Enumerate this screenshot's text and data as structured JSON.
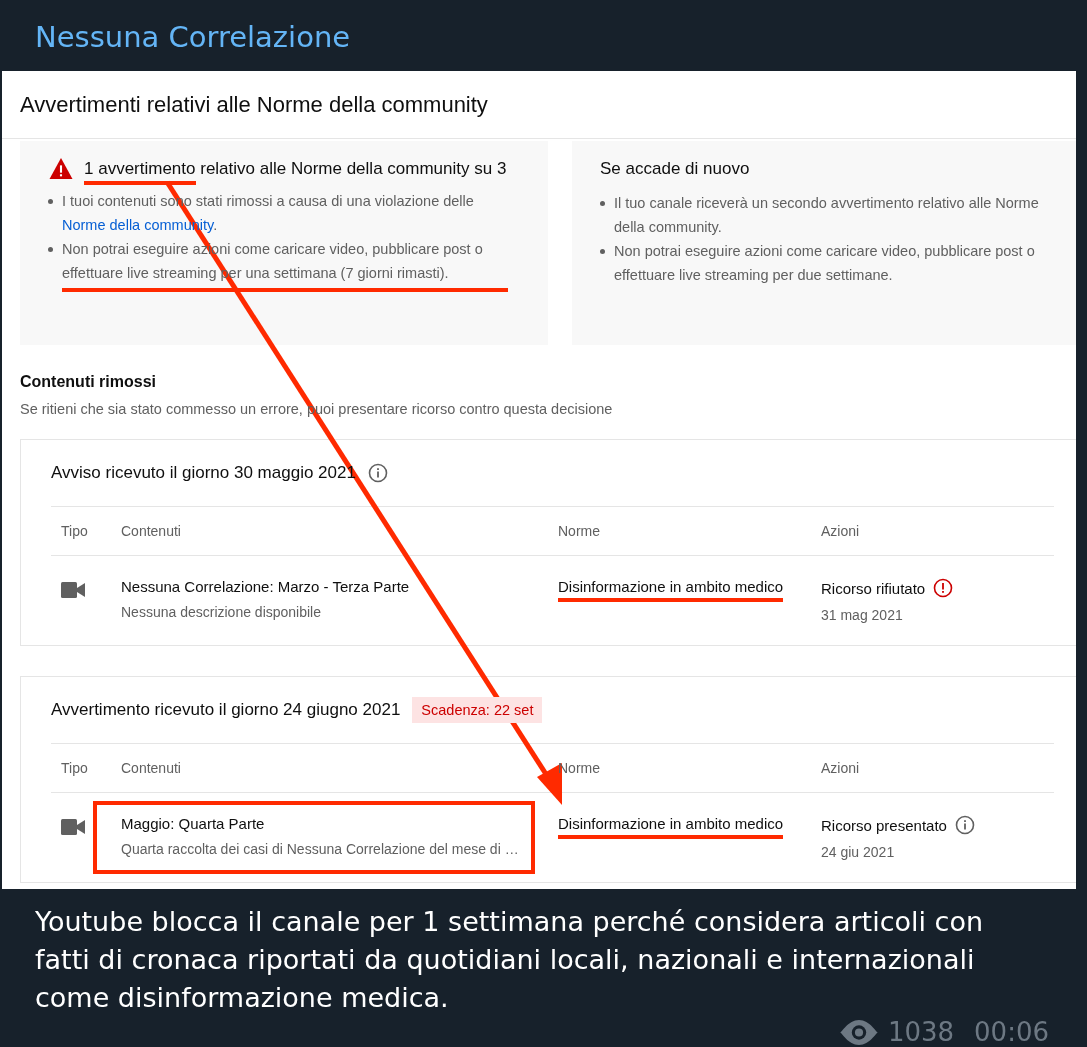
{
  "channel": {
    "name": "Nessuna Correlazione"
  },
  "page": {
    "title": "Avvertimenti relativi alle Norme della community",
    "strike_card": {
      "heading_lead": "1 avvertimento",
      "heading_rest": "relativo alle Norme della community su 3",
      "lead_underlined": true,
      "bullets": [
        {
          "text": "I tuoi contenuti sono stati rimossi a causa di una violazione delle",
          "link": "Norme della community",
          "after": ".",
          "underlined": false
        },
        {
          "text": "Non potrai eseguire azioni come caricare video, pubblicare post o effettuare live streaming per una settimana (7 giorni rimasti).",
          "underlined": true
        }
      ]
    },
    "repeat_card": {
      "heading": "Se accade di nuovo",
      "bullets": [
        {
          "text": "Il tuo canale riceverà un secondo avvertimento relativo alle Norme della community.",
          "underlined": false
        },
        {
          "text": "Non potrai eseguire azioni come caricare video, pubblicare post o effettuare live streaming per due settimane.",
          "underlined": false
        }
      ]
    },
    "removed": {
      "title": "Contenuti rimossi",
      "subtitle": "Se ritieni che sia stato commesso un errore, puoi presentare ricorso contro questa decisione"
    },
    "sections": [
      {
        "heading": "Avviso ricevuto il giorno 30 maggio 2021",
        "info_icon": true,
        "columns": [
          "Tipo",
          "Contenuti",
          "Norme",
          "Azioni"
        ],
        "rows": [
          {
            "title": "Nessuna Correlazione: Marzo - Terza Parte",
            "description": "Nessuna descrizione disponibile",
            "policy": "Disinformazione in ambito medico",
            "policy_underlined": true,
            "action": "Ricorso rifiutato",
            "rejected": true,
            "date": "31 mag 2021",
            "boxed": false
          }
        ]
      },
      {
        "heading": "Avvertimento ricevuto il giorno 24 giugno 2021",
        "badge": "Scadenza: 22 set",
        "info_icon": false,
        "columns": [
          "Tipo",
          "Contenuti",
          "Norme",
          "Azioni"
        ],
        "rows": [
          {
            "title": "Maggio: Quarta Parte",
            "description": "Quarta raccolta dei casi di Nessuna Correlazione del mese di …",
            "policy": "Disinformazione in ambito medico",
            "policy_underlined": true,
            "action": "Ricorso presentato",
            "rejected": false,
            "date": "24 giu 2021",
            "boxed": true
          }
        ]
      }
    ]
  },
  "caption": "Youtube blocca il canale per 1 settimana perché considera articoli con fatti di cronaca riportati da quotidiani locali, nazionali e internazionali come disinformazione medica.",
  "views": "1038",
  "time": "00:06"
}
